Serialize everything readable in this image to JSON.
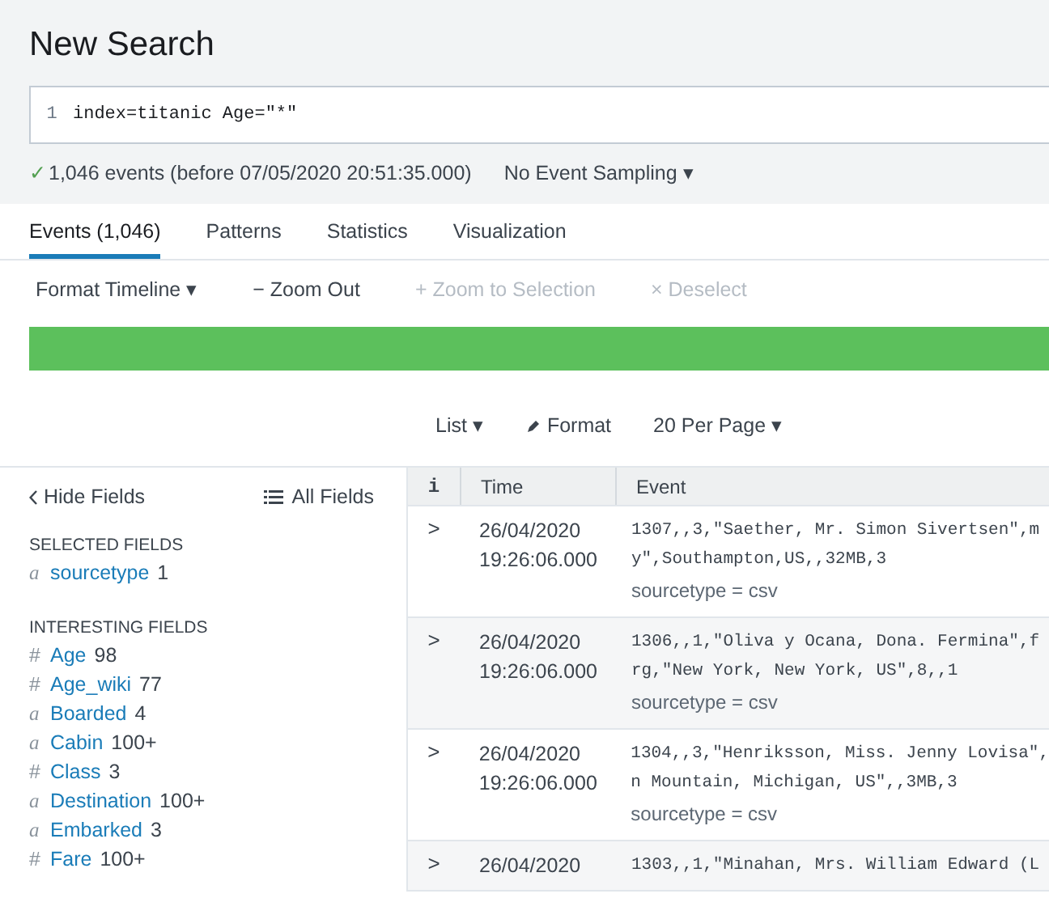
{
  "title": "New Search",
  "search": {
    "line_number": "1",
    "value": "index=titanic Age=\"*\""
  },
  "status": {
    "check": "✓",
    "text": "1,046 events (before 07/05/2020 20:51:35.000)",
    "sampling": "No Event Sampling ▾"
  },
  "tabs": [
    {
      "label": "Events (1,046)",
      "selected": true
    },
    {
      "label": "Patterns",
      "selected": false
    },
    {
      "label": "Statistics",
      "selected": false
    },
    {
      "label": "Visualization",
      "selected": false
    }
  ],
  "timeline_toolbar": [
    {
      "label": "Format Timeline ▾",
      "disabled": false
    },
    {
      "label": "− Zoom Out",
      "disabled": false
    },
    {
      "label": "+ Zoom to Selection",
      "disabled": true
    },
    {
      "label": "× Deselect",
      "disabled": true
    }
  ],
  "timeline": {
    "level": 1
  },
  "view_options": [
    "List ▾",
    "Format",
    "20 Per Page ▾"
  ],
  "sidebar": {
    "hide": "Hide Fields",
    "all": "All Fields",
    "sections": [
      {
        "heading": "SELECTED FIELDS",
        "fields": [
          {
            "type": "a",
            "name": "sourcetype",
            "count": "1"
          }
        ]
      },
      {
        "heading": "INTERESTING FIELDS",
        "fields": [
          {
            "type": "#",
            "name": "Age",
            "count": "98"
          },
          {
            "type": "#",
            "name": "Age_wiki",
            "count": "77"
          },
          {
            "type": "a",
            "name": "Boarded",
            "count": "4"
          },
          {
            "type": "a",
            "name": "Cabin",
            "count": "100+"
          },
          {
            "type": "#",
            "name": "Class",
            "count": "3"
          },
          {
            "type": "a",
            "name": "Destination",
            "count": "100+"
          },
          {
            "type": "a",
            "name": "Embarked",
            "count": "3"
          },
          {
            "type": "#",
            "name": "Fare",
            "count": "100+"
          }
        ]
      }
    ]
  },
  "table": {
    "columns": [
      "i",
      "Time",
      "Event"
    ],
    "rows": [
      {
        "expander": ">",
        "time": [
          "26/04/2020",
          "19:26:06.000"
        ],
        "event": [
          "1307,,3,\"Saether, Mr. Simon Sivertsen\",m",
          "y\",Southampton,US,,32MB,3"
        ],
        "meta": "sourcetype = csv"
      },
      {
        "expander": ">",
        "time": [
          "26/04/2020",
          "19:26:06.000"
        ],
        "event": [
          "1306,,1,\"Oliva y Ocana, Dona. Fermina\",f",
          "rg,\"New York, New York, US\",8,,1"
        ],
        "meta": "sourcetype = csv"
      },
      {
        "expander": ">",
        "time": [
          "26/04/2020",
          "19:26:06.000"
        ],
        "event": [
          "1304,,3,\"Henriksson, Miss. Jenny Lovisa\",",
          "n Mountain, Michigan, US\",,3MB,3"
        ],
        "meta": "sourcetype = csv"
      },
      {
        "expander": ">",
        "time": [
          "26/04/2020"
        ],
        "event": [
          "1303,,1,\"Minahan, Mrs. William Edward (L"
        ]
      }
    ]
  }
}
